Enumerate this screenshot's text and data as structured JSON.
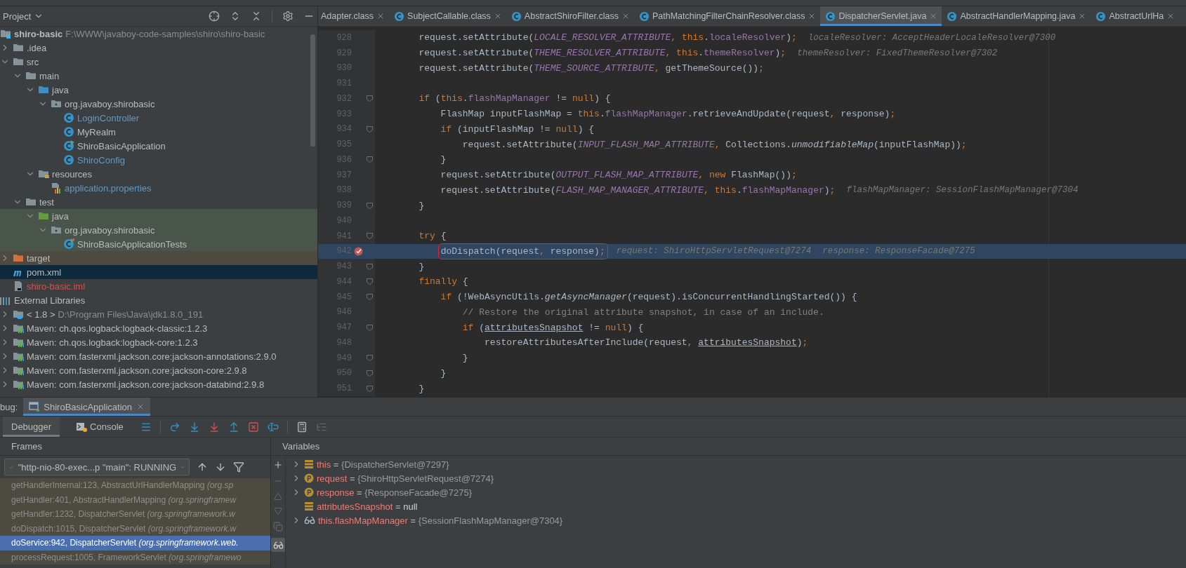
{
  "project_panel": {
    "title": "Project",
    "tree": [
      {
        "kind": "module",
        "label": "shiro-basic",
        "path": "F:\\WWW\\javaboy-code-samples\\shiro\\shiro-basic",
        "selected": false,
        "children": [
          {
            "kind": "folder",
            "label": ".idea",
            "expanded": false,
            "selected": false
          },
          {
            "kind": "folder",
            "label": "src",
            "expanded": true,
            "selected": false,
            "children": [
              {
                "kind": "folder",
                "label": "main",
                "expanded": true,
                "selected": false,
                "children": [
                  {
                    "kind": "source-folder",
                    "label": "java",
                    "expanded": true,
                    "selected": false,
                    "children": [
                      {
                        "kind": "package",
                        "label": "org.javaboy.shirobasic",
                        "expanded": true,
                        "selected": false,
                        "children": [
                          {
                            "kind": "class",
                            "label": "LoginController",
                            "modified": true,
                            "selected": false
                          },
                          {
                            "kind": "class",
                            "label": "MyRealm",
                            "selected": false
                          },
                          {
                            "kind": "run-class",
                            "label": "ShiroBasicApplication",
                            "selected": false
                          },
                          {
                            "kind": "class",
                            "label": "ShiroConfig",
                            "modified": true,
                            "selected": false
                          }
                        ]
                      }
                    ]
                  },
                  {
                    "kind": "resources-folder",
                    "label": "resources",
                    "expanded": true,
                    "selected": false,
                    "children": [
                      {
                        "kind": "properties",
                        "label": "application.properties",
                        "modified": true,
                        "selected": false
                      }
                    ]
                  }
                ]
              },
              {
                "kind": "folder",
                "label": "test",
                "expanded": true,
                "selected": false,
                "children": [
                  {
                    "kind": "test-folder",
                    "label": "java",
                    "expanded": true,
                    "test_source": true,
                    "selected": false,
                    "children": [
                      {
                        "kind": "package",
                        "label": "org.javaboy.shirobasic",
                        "expanded": true,
                        "test_source": true,
                        "selected": false,
                        "children": [
                          {
                            "kind": "test-class",
                            "label": "ShiroBasicApplicationTests",
                            "test_source": true,
                            "selected": false
                          }
                        ]
                      }
                    ]
                  }
                ]
              }
            ]
          },
          {
            "kind": "excluded-folder",
            "label": "target",
            "expanded": false,
            "excluded": true,
            "selected": false
          },
          {
            "kind": "maven",
            "label": "pom.xml",
            "selected": true
          },
          {
            "kind": "iml",
            "label": "shiro-basic.iml",
            "unversioned": true,
            "selected": false
          }
        ]
      },
      {
        "kind": "libraries",
        "label": "External Libraries",
        "selected": false,
        "children": [
          {
            "kind": "jdk",
            "label": "< 1.8 >",
            "path": "D:\\Program Files\\Java\\jdk1.8.0_191",
            "expanded": false,
            "selected": false
          },
          {
            "kind": "library",
            "label": "Maven: ch.qos.logback:logback-classic:1.2.3",
            "expanded": false,
            "selected": false
          },
          {
            "kind": "library",
            "label": "Maven: ch.qos.logback:logback-core:1.2.3",
            "expanded": false,
            "selected": false
          },
          {
            "kind": "library",
            "label": "Maven: com.fasterxml.jackson.core:jackson-annotations:2.9.0",
            "expanded": false,
            "selected": false
          },
          {
            "kind": "library",
            "label": "Maven: com.fasterxml.jackson.core:jackson-core:2.9.8",
            "expanded": false,
            "selected": false
          },
          {
            "kind": "library",
            "label": "Maven: com.fasterxml.jackson.core:jackson-databind:2.9.8",
            "expanded": false,
            "selected": false
          }
        ]
      }
    ]
  },
  "editor": {
    "tabs": [
      {
        "label": "Adapter.class",
        "kind": "text",
        "selected": false
      },
      {
        "label": "SubjectCallable.class",
        "kind": "class",
        "selected": false
      },
      {
        "label": "AbstractShiroFilter.class",
        "kind": "class",
        "selected": false
      },
      {
        "label": "PathMatchingFilterChainResolver.class",
        "kind": "class",
        "selected": false
      },
      {
        "label": "DispatcherServlet.java",
        "kind": "class",
        "selected": true
      },
      {
        "label": "AbstractHandlerMapping.java",
        "kind": "class",
        "selected": false
      },
      {
        "label": "AbstractUrlHa",
        "kind": "class",
        "selected": false
      }
    ],
    "lines": [
      {
        "number": "928",
        "fold": false,
        "breakpoint": false,
        "current": false,
        "tokens": [
          {
            "text": "        request.setAttribute(",
            "kind": "plain"
          },
          {
            "text": "LOCALE_RESOLVER_ATTRIBUTE",
            "kind": "constant"
          },
          {
            "text": ", ",
            "kind": "keyword"
          },
          {
            "text": "this",
            "kind": "keyword"
          },
          {
            "text": ".",
            "kind": "plain"
          },
          {
            "text": "localeResolver",
            "kind": "field"
          },
          {
            "text": ")",
            "kind": "plain"
          },
          {
            "text": ";",
            "kind": "keyword"
          }
        ],
        "hints": [
          "localeResolver: AcceptHeaderLocaleResolver@7300"
        ]
      },
      {
        "number": "929",
        "fold": false,
        "breakpoint": false,
        "current": false,
        "tokens": [
          {
            "text": "        request.setAttribute(",
            "kind": "plain"
          },
          {
            "text": "THEME_RESOLVER_ATTRIBUTE",
            "kind": "constant"
          },
          {
            "text": ", ",
            "kind": "keyword"
          },
          {
            "text": "this",
            "kind": "keyword"
          },
          {
            "text": ".",
            "kind": "plain"
          },
          {
            "text": "themeResolver",
            "kind": "field"
          },
          {
            "text": ")",
            "kind": "plain"
          },
          {
            "text": ";",
            "kind": "keyword"
          }
        ],
        "hints": [
          "themeResolver: FixedThemeResolver@7302"
        ]
      },
      {
        "number": "930",
        "fold": false,
        "breakpoint": false,
        "current": false,
        "tokens": [
          {
            "text": "        request.setAttribute(",
            "kind": "plain"
          },
          {
            "text": "THEME_SOURCE_ATTRIBUTE",
            "kind": "constant"
          },
          {
            "text": ", ",
            "kind": "keyword"
          },
          {
            "text": "getThemeSource())",
            "kind": "plain"
          },
          {
            "text": ";",
            "kind": "keyword"
          }
        ]
      },
      {
        "number": "931",
        "fold": false,
        "breakpoint": false,
        "current": false
      },
      {
        "number": "932",
        "fold": true,
        "breakpoint": false,
        "current": false,
        "tokens": [
          {
            "text": "        if",
            "kind": "keyword"
          },
          {
            "text": " (",
            "kind": "plain"
          },
          {
            "text": "this",
            "kind": "keyword"
          },
          {
            "text": ".",
            "kind": "plain"
          },
          {
            "text": "flashMapManager",
            "kind": "field"
          },
          {
            "text": " != ",
            "kind": "plain"
          },
          {
            "text": "null",
            "kind": "keyword"
          },
          {
            "text": ") {",
            "kind": "plain"
          }
        ]
      },
      {
        "number": "933",
        "fold": false,
        "breakpoint": false,
        "current": false,
        "tokens": [
          {
            "text": "            FlashMap inputFlashMap = ",
            "kind": "plain"
          },
          {
            "text": "this",
            "kind": "keyword"
          },
          {
            "text": ".",
            "kind": "plain"
          },
          {
            "text": "flashMapManager",
            "kind": "field"
          },
          {
            "text": ".retrieveAndUpdate(request",
            "kind": "plain"
          },
          {
            "text": ", ",
            "kind": "keyword"
          },
          {
            "text": "response)",
            "kind": "plain"
          },
          {
            "text": ";",
            "kind": "keyword"
          }
        ]
      },
      {
        "number": "934",
        "fold": true,
        "breakpoint": false,
        "current": false,
        "tokens": [
          {
            "text": "            if",
            "kind": "keyword"
          },
          {
            "text": " (inputFlashMap != ",
            "kind": "plain"
          },
          {
            "text": "null",
            "kind": "keyword"
          },
          {
            "text": ") {",
            "kind": "plain"
          }
        ]
      },
      {
        "number": "935",
        "fold": false,
        "breakpoint": false,
        "current": false,
        "tokens": [
          {
            "text": "                request.setAttribute(",
            "kind": "plain"
          },
          {
            "text": "INPUT_FLASH_MAP_ATTRIBUTE",
            "kind": "constant"
          },
          {
            "text": ", ",
            "kind": "keyword"
          },
          {
            "text": "Collections.",
            "kind": "plain"
          },
          {
            "text": "unmodifiableMap",
            "kind": "static"
          },
          {
            "text": "(inputFlashMap))",
            "kind": "plain"
          },
          {
            "text": ";",
            "kind": "keyword"
          }
        ]
      },
      {
        "number": "936",
        "fold": true,
        "breakpoint": false,
        "current": false,
        "tokens": [
          {
            "text": "            }",
            "kind": "plain"
          }
        ]
      },
      {
        "number": "937",
        "fold": false,
        "breakpoint": false,
        "current": false,
        "tokens": [
          {
            "text": "            request.setAttribute(",
            "kind": "plain"
          },
          {
            "text": "OUTPUT_FLASH_MAP_ATTRIBUTE",
            "kind": "constant"
          },
          {
            "text": ", ",
            "kind": "keyword"
          },
          {
            "text": "new ",
            "kind": "keyword"
          },
          {
            "text": "FlashMap())",
            "kind": "plain"
          },
          {
            "text": ";",
            "kind": "keyword"
          }
        ]
      },
      {
        "number": "938",
        "fold": false,
        "breakpoint": false,
        "current": false,
        "tokens": [
          {
            "text": "            request.setAttribute(",
            "kind": "plain"
          },
          {
            "text": "FLASH_MAP_MANAGER_ATTRIBUTE",
            "kind": "constant"
          },
          {
            "text": ", ",
            "kind": "keyword"
          },
          {
            "text": "this",
            "kind": "keyword"
          },
          {
            "text": ".",
            "kind": "plain"
          },
          {
            "text": "flashMapManager",
            "kind": "field"
          },
          {
            "text": ")",
            "kind": "plain"
          },
          {
            "text": ";",
            "kind": "keyword"
          }
        ],
        "hints": [
          "flashMapManager: SessionFlashMapManager@7304"
        ]
      },
      {
        "number": "939",
        "fold": true,
        "breakpoint": false,
        "current": false,
        "tokens": [
          {
            "text": "        }",
            "kind": "plain"
          }
        ]
      },
      {
        "number": "940",
        "fold": false,
        "breakpoint": false,
        "current": false
      },
      {
        "number": "941",
        "fold": true,
        "breakpoint": false,
        "current": false,
        "tokens": [
          {
            "text": "        try",
            "kind": "keyword"
          },
          {
            "text": " {",
            "kind": "plain"
          }
        ]
      },
      {
        "number": "942",
        "fold": false,
        "breakpoint": true,
        "current": true,
        "tokens": [
          {
            "text": "            doDispatch(request",
            "kind": "plain",
            "boxed": true
          },
          {
            "text": ", ",
            "kind": "keyword",
            "boxed": true
          },
          {
            "text": "response)",
            "kind": "plain",
            "boxed": true
          },
          {
            "text": ";",
            "kind": "keyword",
            "boxed": true
          }
        ],
        "hints": [
          "request: ShiroHttpServletRequest@7274",
          "response: ResponseFacade@7275"
        ]
      },
      {
        "number": "943",
        "fold": true,
        "breakpoint": false,
        "current": false,
        "tokens": [
          {
            "text": "        }",
            "kind": "plain"
          }
        ]
      },
      {
        "number": "944",
        "fold": true,
        "breakpoint": false,
        "current": false,
        "tokens": [
          {
            "text": "        finally",
            "kind": "keyword"
          },
          {
            "text": " {",
            "kind": "plain"
          }
        ]
      },
      {
        "number": "945",
        "fold": true,
        "breakpoint": false,
        "current": false,
        "tokens": [
          {
            "text": "            if",
            "kind": "keyword"
          },
          {
            "text": " (!WebAsyncUtils.",
            "kind": "plain"
          },
          {
            "text": "getAsyncManager",
            "kind": "static"
          },
          {
            "text": "(request).isConcurrentHandlingStarted()) {",
            "kind": "plain"
          }
        ]
      },
      {
        "number": "946",
        "fold": false,
        "breakpoint": false,
        "current": false,
        "tokens": [
          {
            "text": "                // Restore the original attribute snapshot, in case of an include.",
            "kind": "comment"
          }
        ]
      },
      {
        "number": "947",
        "fold": true,
        "breakpoint": false,
        "current": false,
        "tokens": [
          {
            "text": "                if",
            "kind": "keyword"
          },
          {
            "text": " (",
            "kind": "plain"
          },
          {
            "text": "attributesSnapshot",
            "kind": "underlined"
          },
          {
            "text": " != ",
            "kind": "plain"
          },
          {
            "text": "null",
            "kind": "keyword"
          },
          {
            "text": ") {",
            "kind": "plain"
          }
        ]
      },
      {
        "number": "948",
        "fold": false,
        "breakpoint": false,
        "current": false,
        "tokens": [
          {
            "text": "                    restoreAttributesAfterInclude(request",
            "kind": "plain"
          },
          {
            "text": ", ",
            "kind": "keyword"
          },
          {
            "text": "attributesSnapshot",
            "kind": "underlined"
          },
          {
            "text": ")",
            "kind": "plain"
          },
          {
            "text": ";",
            "kind": "keyword"
          }
        ]
      },
      {
        "number": "949",
        "fold": true,
        "breakpoint": false,
        "current": false,
        "tokens": [
          {
            "text": "                }",
            "kind": "plain"
          }
        ]
      },
      {
        "number": "950",
        "fold": true,
        "breakpoint": false,
        "current": false,
        "tokens": [
          {
            "text": "            }",
            "kind": "plain"
          }
        ]
      },
      {
        "number": "951",
        "fold": true,
        "breakpoint": false,
        "current": false,
        "tokens": [
          {
            "text": "        }",
            "kind": "plain"
          }
        ]
      }
    ]
  },
  "debug": {
    "label": "bug:",
    "session": "ShiroBasicApplication",
    "tabs": [
      {
        "label": "Debugger",
        "selected": true
      },
      {
        "label": "Console",
        "selected": false
      }
    ],
    "frames": {
      "title": "Frames",
      "thread": "\"http-nio-80-exec...p \"main\": RUNNING",
      "items": [
        {
          "method": "getHandlerInternal:123, AbstractUrlHandlerMapping",
          "package": "(org.sp",
          "library": true,
          "selected": false
        },
        {
          "method": "getHandler:401, AbstractHandlerMapping",
          "package": "(org.springframew",
          "library": true,
          "selected": false
        },
        {
          "method": "getHandler:1232, DispatcherServlet",
          "package": "(org.springframework.w",
          "library": true,
          "selected": false
        },
        {
          "method": "doDispatch:1015, DispatcherServlet",
          "package": "(org.springframework.w",
          "library": true,
          "selected": false
        },
        {
          "method": "doService:942, DispatcherServlet",
          "package": "(org.springframework.web.",
          "library": true,
          "selected": true
        },
        {
          "method": "processRequest:1005, FrameworkServlet",
          "package": "(org.springframewo",
          "library": true,
          "selected": false
        }
      ]
    },
    "variables": {
      "title": "Variables",
      "items": [
        {
          "kind": "field",
          "name": "this",
          "operator": "=",
          "value": "{DispatcherServlet@7297}",
          "literal": false,
          "expanded": false
        },
        {
          "kind": "parameter",
          "name": "request",
          "operator": "=",
          "value": "{ShiroHttpServletRequest@7274}",
          "literal": false,
          "expanded": false
        },
        {
          "kind": "parameter",
          "name": "response",
          "operator": "=",
          "value": "{ResponseFacade@7275}",
          "literal": false,
          "expanded": false
        },
        {
          "kind": "field",
          "name": "attributesSnapshot",
          "operator": "=",
          "value": "null",
          "literal": true
        },
        {
          "kind": "watch",
          "name": "this.flashMapManager",
          "operator": "=",
          "value": "{SessionFlashMapManager@7304}",
          "literal": false,
          "expanded": false
        }
      ]
    }
  }
}
